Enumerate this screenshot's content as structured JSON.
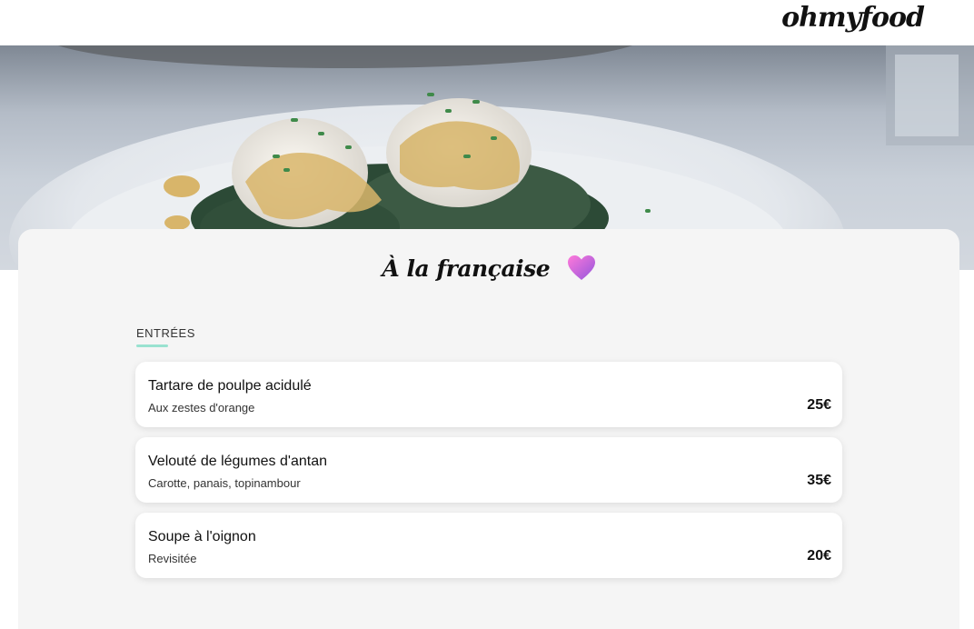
{
  "header": {
    "logo": "ohmyfood"
  },
  "hero": {
    "image": "poached-eggs-dish-photo"
  },
  "restaurant": {
    "title": "À la française",
    "favorite_icon": "heart-icon",
    "heart_colors": [
      "#ff79da",
      "#9356dc"
    ]
  },
  "menu": {
    "section_label": "ENTRÉES",
    "accent_color": "#99e2d0",
    "items": [
      {
        "name": "Tartare de poulpe acidulé",
        "description": "Aux zestes d'orange",
        "price": "25€"
      },
      {
        "name": "Velouté de légumes d'antan",
        "description": "Carotte, panais, topinambour",
        "price": "35€"
      },
      {
        "name": "Soupe à l'oignon",
        "description": "Revisitée",
        "price": "20€"
      }
    ]
  }
}
